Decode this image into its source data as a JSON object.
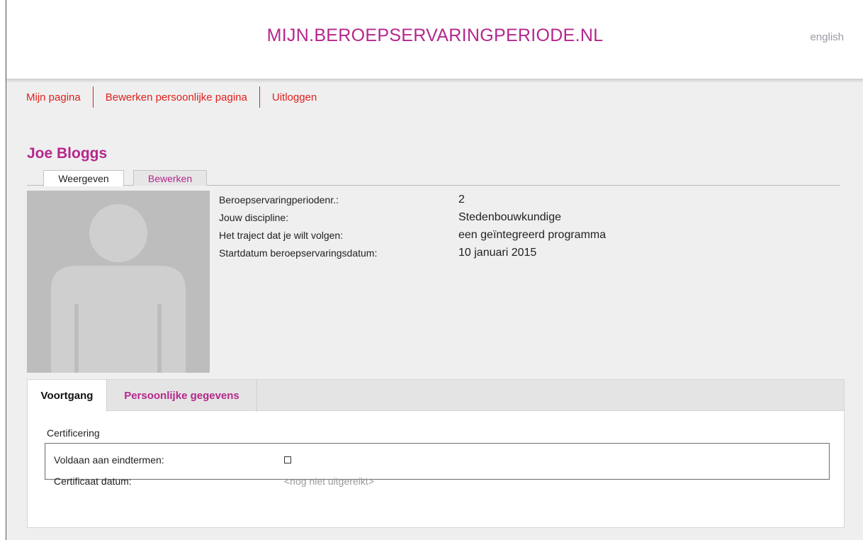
{
  "header": {
    "site_title": "MIJN.BEROEPSERVARINGPERIODE.NL",
    "language_link": "english"
  },
  "nav": {
    "items": [
      {
        "label": "Mijn pagina"
      },
      {
        "label": "Bewerken persoonlijke pagina"
      },
      {
        "label": "Uitloggen"
      }
    ]
  },
  "profile": {
    "name": "Joe Bloggs",
    "tabs": [
      {
        "label": "Weergeven",
        "active": true
      },
      {
        "label": "Bewerken",
        "active": false
      }
    ],
    "fields": [
      {
        "label": "Beroepservaringperiodenr.:",
        "value": "2"
      },
      {
        "label": "Jouw discipline:",
        "value": "Stedenbouwkundige"
      },
      {
        "label": "Het traject dat je wilt volgen:",
        "value": "een geïntegreerd programma"
      },
      {
        "label": "Startdatum beroepservaringsdatum:",
        "value": "10 januari 2015"
      }
    ]
  },
  "panel": {
    "tabs": [
      {
        "label": "Voortgang",
        "active": true
      },
      {
        "label": "Persoonlijke gegevens",
        "active": false
      }
    ],
    "certification": {
      "title": "Certificering",
      "rows": [
        {
          "label": "Voldaan aan eindtermen:",
          "checked": false
        },
        {
          "label": "Certificaat datum:",
          "value": "<nog niet uitgereikt>"
        }
      ]
    }
  },
  "colors": {
    "brand": "#b5268c",
    "nav_link": "#e0201d",
    "avatar_bg": "#bdbdbd",
    "avatar_fg": "#cfcfcf"
  }
}
